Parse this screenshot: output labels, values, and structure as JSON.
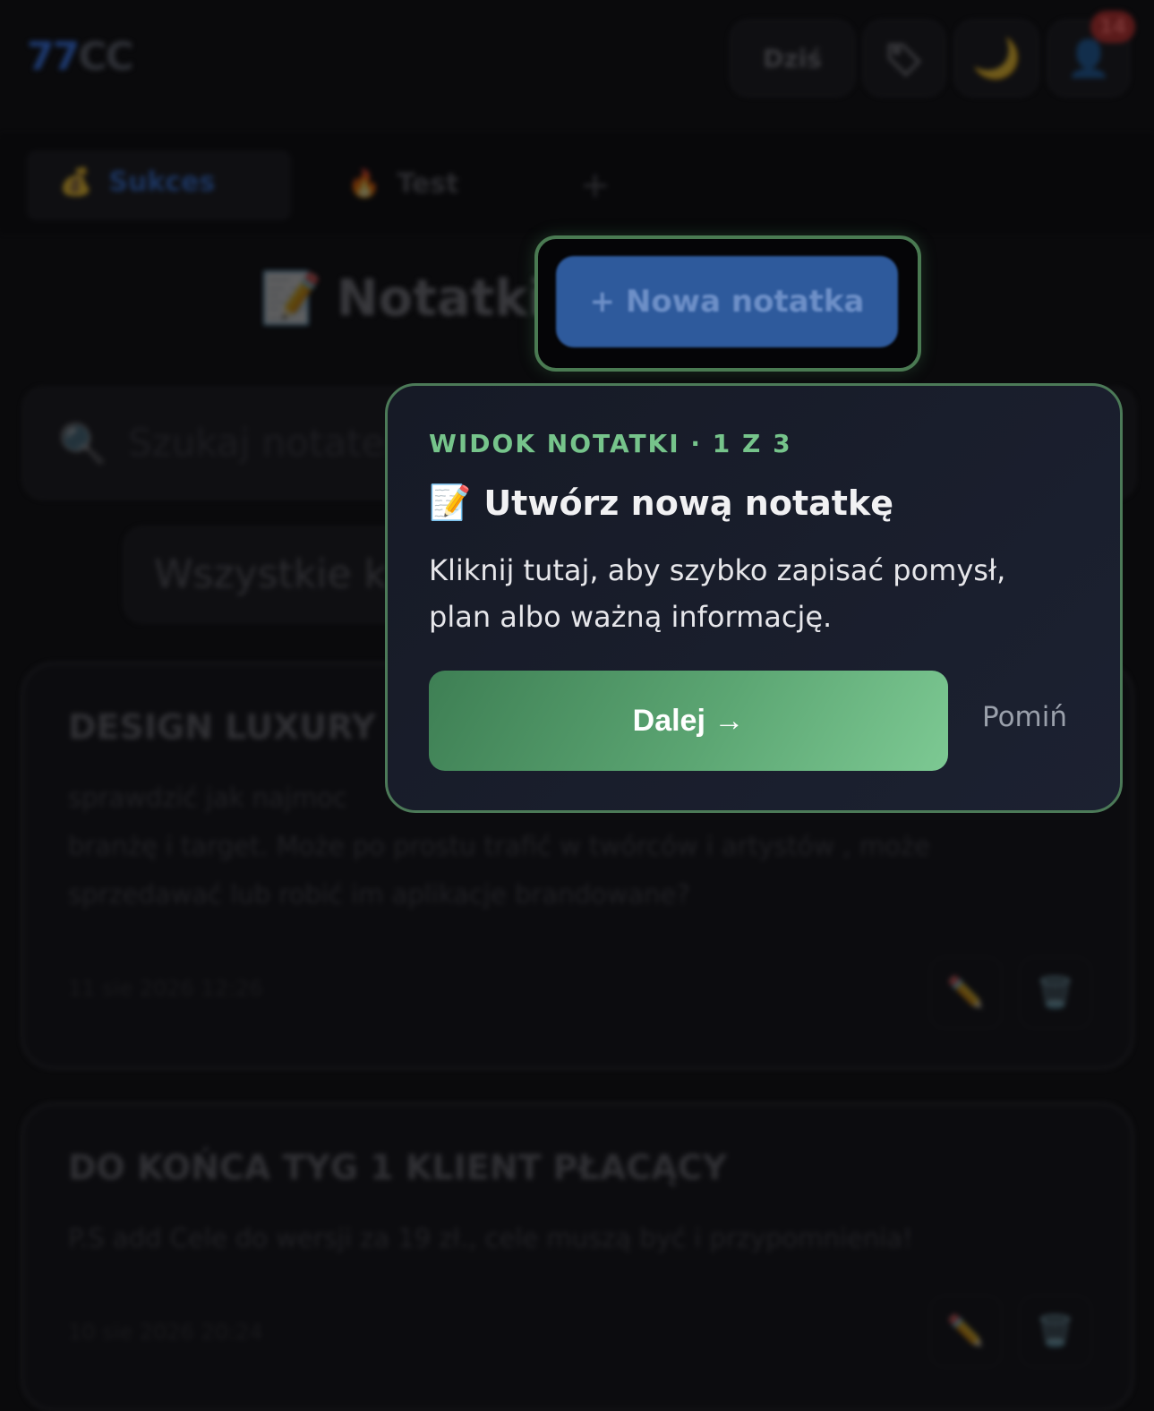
{
  "header": {
    "logo_part1": "77",
    "logo_part2": "CC",
    "today_label": "Dziś",
    "tag_icon": "tag-icon",
    "theme_icon": "moon-icon",
    "profile_icon": "user-icon",
    "notification_count": "14"
  },
  "tabs": [
    {
      "emoji": "💰",
      "label": "Sukces"
    },
    {
      "emoji": "🔥",
      "label": "Test"
    }
  ],
  "add_tab_label": "+",
  "section": {
    "title_emoji": "📝",
    "title": "Notatki",
    "new_note_label": "+ Nowa notatka"
  },
  "search": {
    "icon": "🔍",
    "placeholder": "Szukaj notatek"
  },
  "filter": {
    "selected": "Wszystkie k"
  },
  "notes": [
    {
      "title": "DESIGN LUXURY",
      "body_lines": [
        "sprawdzić jak najmoc",
        "branżę i target. Może po prostu trafić w twórców i artystów , może",
        "sprzedawać lub robić im aplikacje brandowane?"
      ],
      "date": "11 sie 2026 12:26"
    },
    {
      "title": "DO KOŃCA TYG 1 KLIENT PŁACĄCY",
      "body_lines": [
        "P.S add Cele do wersji za 19 zł., cele muszą być i przypomnienia!"
      ],
      "date": "10 sie 2026 20:24"
    }
  ],
  "tour": {
    "step_label": "WIDOK NOTATKI · 1 Z 3",
    "title_emoji": "📝",
    "title": "Utwórz nową notatkę",
    "description": "Kliknij tutaj, aby szybko zapisać pomysł, plan albo ważną informację.",
    "next_label": "Dalej →",
    "skip_label": "Pomiń"
  },
  "colors": {
    "accent_green": "#76c48b",
    "primary_blue": "#2e5a9c",
    "popover_bg": "#1a1e2c"
  }
}
